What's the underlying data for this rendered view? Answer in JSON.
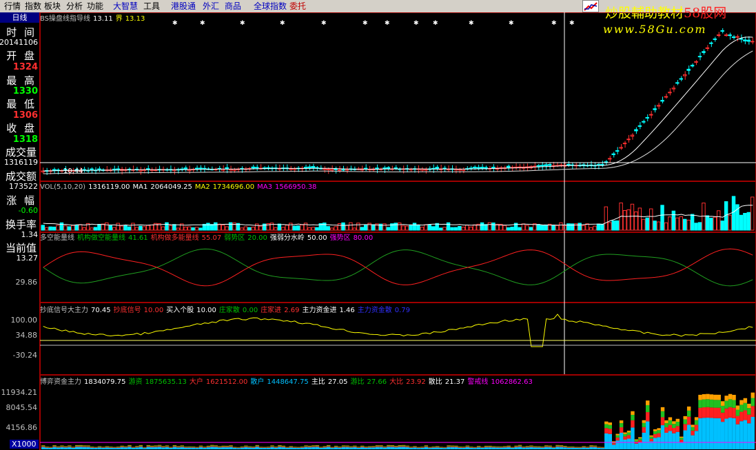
{
  "menu": [
    {
      "label": "行情",
      "color": "#000000"
    },
    {
      "label": "指数",
      "color": "#000000"
    },
    {
      "label": "板块",
      "color": "#000000"
    },
    {
      "label": "分析",
      "color": "#000000"
    },
    {
      "label": "功能",
      "color": "#000000"
    },
    {
      "label": "大智慧",
      "color": "#0000c0"
    },
    {
      "label": "工具",
      "color": "#000000"
    },
    {
      "label": "港股通",
      "color": "#0000c0"
    },
    {
      "label": "外汇",
      "color": "#0000c0"
    },
    {
      "label": "商品",
      "color": "#0000c0"
    },
    {
      "label": "全球指数",
      "color": "#0000c0"
    },
    {
      "label": "委托",
      "color": "#c00000"
    }
  ],
  "logo": {
    "line1_prefix": "炒股輔助教材",
    "line1_accent": "58股网",
    "line2": "www.58Gu.com"
  },
  "sidebar": {
    "period": "日线",
    "time_label": "时 间",
    "time_value": "20141106",
    "open_label": "开 盘",
    "open_value": "1324",
    "high_label": "最 高",
    "high_value": "1330",
    "low_label": "最 低",
    "low_value": "1306",
    "close_label": "收 盘",
    "close_value": "1318",
    "volume_label": "成交量",
    "volume_value": "1316119",
    "amount_label": "成交额",
    "amount_value": "173522",
    "change_label": "涨 幅",
    "change_value": "-0.60",
    "turnover_label": "换手率",
    "turnover_value": "1.34",
    "current_label": "当前值",
    "current_value": "13.27"
  },
  "price_panel": {
    "title": "BS操盘线指导线",
    "v1": "13.11",
    "v2_label": "界",
    "v2": "13.13",
    "low_marker": "10.44",
    "axis_labels": []
  },
  "volume_panel": {
    "legend": [
      {
        "text": "VOL(5,10,20)",
        "color": "#c0c0c0"
      },
      {
        "text": "1316119.00",
        "color": "#ffffff"
      },
      {
        "text": "MA1",
        "color": "#ffffff"
      },
      {
        "text": "2064049.25",
        "color": "#ffffff"
      },
      {
        "text": "MA2",
        "color": "#ffff00"
      },
      {
        "text": "1734696.00",
        "color": "#ffff00"
      },
      {
        "text": "MA3",
        "color": "#ff00ff"
      },
      {
        "text": "1566950.38",
        "color": "#ff00ff"
      }
    ]
  },
  "power_panel": {
    "legend": [
      {
        "text": "多空能量线",
        "color": "#c0c0c0"
      },
      {
        "text": "机构做空能量线",
        "color": "#00c000"
      },
      {
        "text": "41.61",
        "color": "#00c000"
      },
      {
        "text": "机构做多能量线",
        "color": "#ff3030"
      },
      {
        "text": "55.07",
        "color": "#ff3030"
      },
      {
        "text": "弱势区",
        "color": "#00c000"
      },
      {
        "text": "20.00",
        "color": "#00c000"
      },
      {
        "text": "强弱分水岭",
        "color": "#ffffff"
      },
      {
        "text": "50.00",
        "color": "#ffffff"
      },
      {
        "text": "强势区",
        "color": "#ff00ff"
      },
      {
        "text": "80.00",
        "color": "#ff00ff"
      }
    ],
    "axis_labels": [
      "29.86"
    ]
  },
  "bottom_signal_panel": {
    "legend": [
      {
        "text": "抄底信号大主力",
        "color": "#c0c0c0"
      },
      {
        "text": "70.45",
        "color": "#ffffff"
      },
      {
        "text": "抄底信号",
        "color": "#ff3030"
      },
      {
        "text": "10.00",
        "color": "#ff3030"
      },
      {
        "text": "买入个股",
        "color": "#ffffff"
      },
      {
        "text": "10.00",
        "color": "#ffffff"
      },
      {
        "text": "庄家散",
        "color": "#00c000"
      },
      {
        "text": "0.00",
        "color": "#00c000"
      },
      {
        "text": "庄家进",
        "color": "#ff3030"
      },
      {
        "text": "2.69",
        "color": "#ff3030"
      },
      {
        "text": "主力资金进",
        "color": "#ffffff"
      },
      {
        "text": "1.46",
        "color": "#ffffff"
      },
      {
        "text": "主力资金散",
        "color": "#3030ff"
      },
      {
        "text": "0.79",
        "color": "#3030ff"
      }
    ],
    "axis_labels": [
      "100.00",
      "34.88",
      "-30.24"
    ]
  },
  "capital_panel": {
    "legend": [
      {
        "text": "博弈资金主力",
        "color": "#c0c0c0"
      },
      {
        "text": "1834079.75",
        "color": "#ffffff"
      },
      {
        "text": "游资",
        "color": "#00c000"
      },
      {
        "text": "1875635.13",
        "color": "#00c000"
      },
      {
        "text": "大户",
        "color": "#ff3030"
      },
      {
        "text": "1621512.00",
        "color": "#ff3030"
      },
      {
        "text": "散户",
        "color": "#00c0ff"
      },
      {
        "text": "1448647.75",
        "color": "#00c0ff"
      },
      {
        "text": "主比",
        "color": "#ffffff"
      },
      {
        "text": "27.05",
        "color": "#ffffff"
      },
      {
        "text": "游比",
        "color": "#00c000"
      },
      {
        "text": "27.66",
        "color": "#00c000"
      },
      {
        "text": "大比",
        "color": "#ff3030"
      },
      {
        "text": "23.92",
        "color": "#ff3030"
      },
      {
        "text": "散比",
        "color": "#ffffff"
      },
      {
        "text": "21.37",
        "color": "#ffffff"
      },
      {
        "text": "警戒线",
        "color": "#ff00ff"
      },
      {
        "text": "1062862.63",
        "color": "#ff00ff"
      }
    ],
    "axis_labels": [
      "11934.21",
      "8045.54",
      "4156.86"
    ],
    "unit": "X1000"
  },
  "colors": {
    "up": "#ff3030",
    "down": "#00ffff",
    "ma_white": "#ffffff",
    "ma_yellow": "#ffff00",
    "grid": "#a00000",
    "cursor": "#ffffff"
  },
  "chart_data": {
    "type": "candlestick",
    "price_axis_ticks": [],
    "selected_bar": {
      "date": "20141106",
      "open": 1324,
      "high": 1330,
      "low": 1306,
      "close": 1318,
      "volume": 1316119
    }
  }
}
